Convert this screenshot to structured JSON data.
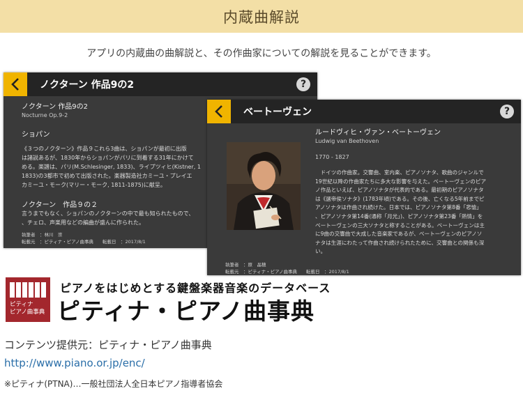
{
  "banner": {
    "title": "内蔵曲解説"
  },
  "intro": "アプリの内蔵曲の曲解説と、その作曲家についての解説を見ることができます。",
  "piece_panel": {
    "header_title": "ノクターン 作品9の2",
    "help": "?",
    "title_ja": "ノクターン 作品9の2",
    "title_en": "Nocturne Op.9-2",
    "composer": "ショパン",
    "paragraphs": [
      "《３つのノクターン》作品９これら3曲は、ショパンが最初に出版",
      "は諸説あるが、1830年からショパンがパリに到着する31年にかけて",
      "める。楽譜は、パリ(M.Schlesinger, 1833)、ライプツィヒ(Kistner, 1",
      "1833)の3都市で初めて出版された。楽器製造社カミーユ・プレイエ",
      "カミーユ・モーク(マリー・モーク, 1811-1875)に献呈。"
    ],
    "section_title": "ノクターン　作品９の２",
    "section_lines": [
      "言うまでもなく、ショパンのノクターンの中で最も知られたもので、",
      "、チェロ、声楽用などの編曲が盛んに作られた。"
    ],
    "footer": {
      "author_line": "執筆者　：林川　崇",
      "source_line": "転載元　：ピティナ・ピアノ曲事典",
      "date_line": "転載日　：2017/8/1"
    }
  },
  "composer_panel": {
    "header_title": "ベートーヴェン",
    "help": "?",
    "name_ja": "ルードヴィヒ・ヴァン・ベートーヴェン",
    "name_en": "Ludwig van Beethoven",
    "years": "1770 - 1827",
    "paragraph_lines": [
      "　ドイツの作曲家。交響曲、室内楽、ピアノソナタ、歌曲のジャンルで",
      "19世紀以降の作曲家たちに多大な影響を与えた。ベートーヴェンのピア",
      "ノ作品といえば、ピアノソナタが代表的である。最初期のピアノソナタ",
      "は《選帝侯ソナタ》(1783年頃)である。その後、亡くなる5年前までピ",
      "アノソナタは作曲され続けた。日本では、ピアノソナタ第8番「悲愴」",
      "、ピアノソナタ第14番(通称「月光」)、ピアノソナタ第23番「熱情」を",
      "ベートーヴェンの三大ソナタと称することがある。ベートーヴェンは主",
      "に9曲の交響曲で大成した音楽家であるが、ベートーヴェンのピアノソ",
      "ナタは生涯にわたって作曲され続けられたために、交響曲との関係も深",
      "い。"
    ],
    "footer": {
      "author_line": "執筆者　：原　晶穂",
      "source_line": "転載元　：ピティナ・ピアノ曲事典",
      "date_line": "転載日　：2017/8/1"
    }
  },
  "logo": {
    "box_line1": "ピティナ",
    "box_line2": "ピアノ曲事典",
    "tagline": "ピアノをはじめとする鍵盤楽器音楽のデータベース",
    "name": "ピティナ・ピアノ曲事典"
  },
  "credits": {
    "provider": "コンテンツ提供元：ピティナ・ピアノ曲事典",
    "url": "http://www.piano.or.jp/enc/",
    "note": "※ピティナ(PTNA)…一般社団法人全日本ピアノ指導者協会"
  },
  "colors": {
    "banner": "#f3dfa6",
    "accent": "#f0b400",
    "panel": "#3a3a3a",
    "header": "#242424",
    "logo": "#a3272d",
    "link": "#2a6ea8"
  }
}
